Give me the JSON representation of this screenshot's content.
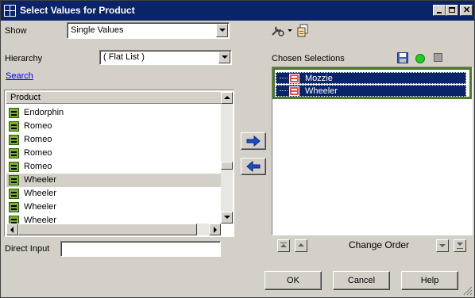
{
  "window": {
    "title": "Select Values for Product",
    "controls": [
      "minimize",
      "maximize",
      "close"
    ]
  },
  "show": {
    "label": "Show",
    "value": "Single Values"
  },
  "toolbar_icons": [
    "options-icon",
    "dropdown-arrow-icon",
    "copy-values-icon"
  ],
  "hierarchy": {
    "label": "Hierarchy",
    "value": "( Flat List )"
  },
  "search": {
    "label": "Search"
  },
  "product_list": {
    "header": "Product",
    "items": [
      {
        "label": "Endorphin"
      },
      {
        "label": "Romeo"
      },
      {
        "label": "Romeo"
      },
      {
        "label": "Romeo"
      },
      {
        "label": "Romeo"
      },
      {
        "label": "Wheeler",
        "selected": true
      },
      {
        "label": "Wheeler"
      },
      {
        "label": "Wheeler"
      },
      {
        "label": "Wheeler"
      }
    ]
  },
  "direct_input": {
    "label": "Direct Input",
    "value": ""
  },
  "chosen": {
    "label": "Chosen Selections",
    "items": [
      {
        "label": "Mozzie"
      },
      {
        "label": "Wheeler"
      }
    ],
    "change_order_label": "Change Order"
  },
  "buttons": {
    "ok": "OK",
    "cancel": "Cancel",
    "help": "Help"
  },
  "colors": {
    "title_bar": "#0a246a",
    "selection": "#0a246a",
    "chosen_border": "#4a7a2a",
    "eq_icon": "#7ab02e",
    "chosen_icon": "#e05050",
    "status_green": "#22cc22",
    "arrow_blue": "#1a4ed8"
  }
}
